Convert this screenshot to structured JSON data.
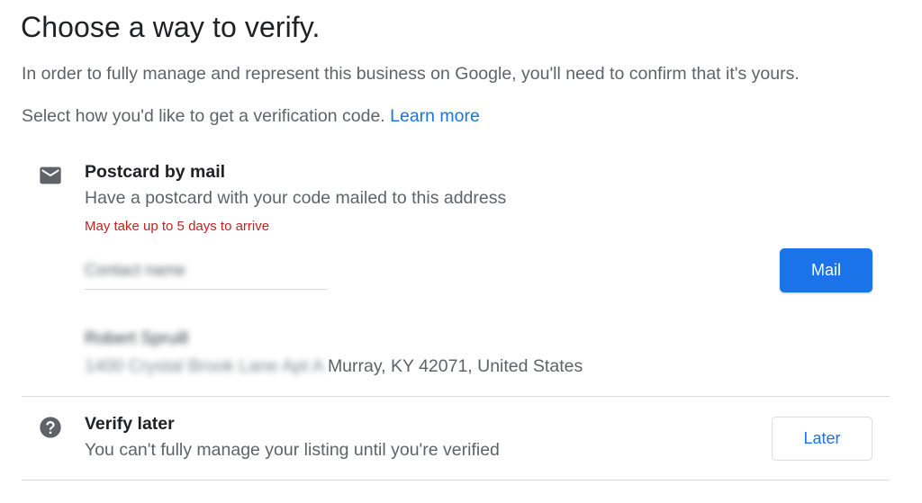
{
  "header": {
    "title": "Choose a way to verify.",
    "intro": "In order to fully manage and represent this business on Google, you'll need to confirm that it's yours.",
    "select_text": "Select how you'd like to get a verification code.",
    "learn_more": "Learn more"
  },
  "options": {
    "postcard": {
      "icon": "mail-icon",
      "title": "Postcard by mail",
      "description": "Have a postcard with your code mailed to this address",
      "warning": "May take up to 5 days to arrive",
      "contact_field_placeholder": "Contact name",
      "address_name": "Robert Spruill",
      "address_street": "1400 Crystal Brook Lane Apt A",
      "address_city": "Murray, KY 42071, United States",
      "button_label": "Mail"
    },
    "later": {
      "icon": "help-circle-icon",
      "title": "Verify later",
      "description": "You can't fully manage your listing until you're verified",
      "button_label": "Later"
    }
  },
  "colors": {
    "accent": "#1a73e8",
    "warning": "#c5221f",
    "text_primary": "#202124",
    "text_secondary": "#5f6368",
    "divider": "#dadce0"
  }
}
